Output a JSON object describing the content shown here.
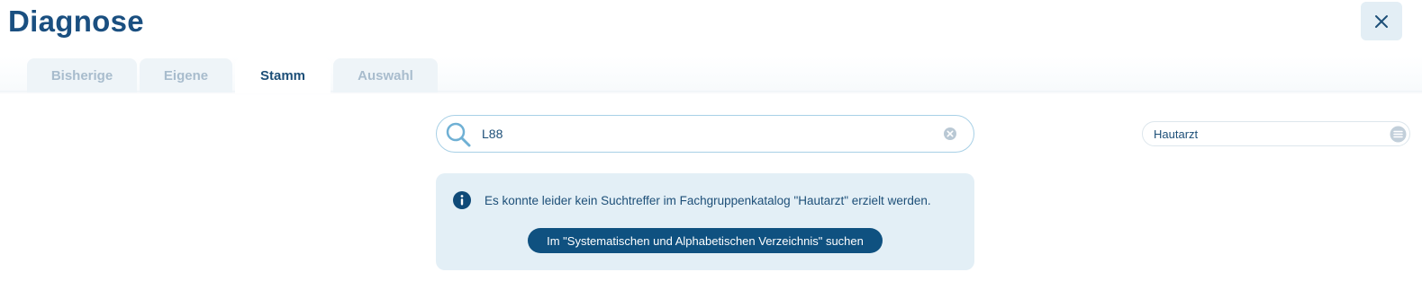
{
  "header": {
    "title": "Diagnose",
    "close_icon": "close-icon"
  },
  "tabs": [
    {
      "label": "Bisherige",
      "active": false
    },
    {
      "label": "Eigene",
      "active": false
    },
    {
      "label": "Stamm",
      "active": true
    },
    {
      "label": "Auswahl",
      "active": false
    }
  ],
  "search": {
    "value": "L88",
    "icon": "search-icon",
    "clear_icon": "clear-icon"
  },
  "catalog": {
    "value": "Hautarzt",
    "menu_icon": "menu-icon"
  },
  "info": {
    "icon": "info-icon",
    "message": "Es konnte leider kein Suchtreffer im Fachgruppenkatalog \"Hautarzt\" erzielt werden.",
    "button_label": "Im \"Systematischen und Alphabetischen Verzeichnis\" suchen"
  },
  "colors": {
    "primary": "#1d4f78",
    "button": "#0f5180",
    "info_bg": "#e3eff6",
    "tab_inactive_bg": "#eef4f8",
    "tab_inactive_text": "#a8bccd"
  }
}
